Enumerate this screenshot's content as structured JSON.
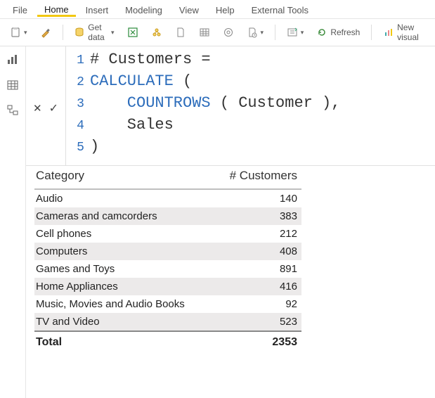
{
  "menubar": {
    "items": [
      {
        "label": "File",
        "active": false
      },
      {
        "label": "Home",
        "active": true
      },
      {
        "label": "Insert",
        "active": false
      },
      {
        "label": "Modeling",
        "active": false
      },
      {
        "label": "View",
        "active": false
      },
      {
        "label": "Help",
        "active": false
      },
      {
        "label": "External Tools",
        "active": false
      }
    ]
  },
  "toolbar": {
    "get_data_label": "Get data",
    "refresh_label": "Refresh",
    "new_visual_label": "New visual"
  },
  "formula": {
    "lines": [
      {
        "n": "1",
        "tokens": [
          {
            "t": "# Customers ",
            "c": "txt"
          },
          {
            "t": "=",
            "c": "txt"
          }
        ]
      },
      {
        "n": "2",
        "tokens": [
          {
            "t": "CALCULATE",
            "c": "kw"
          },
          {
            "t": " (",
            "c": "par"
          }
        ]
      },
      {
        "n": "3",
        "tokens": [
          {
            "t": "    ",
            "c": "txt"
          },
          {
            "t": "COUNTROWS",
            "c": "kw"
          },
          {
            "t": " ( Customer ),",
            "c": "txt"
          }
        ]
      },
      {
        "n": "4",
        "tokens": [
          {
            "t": "    Sales",
            "c": "txt"
          }
        ]
      },
      {
        "n": "5",
        "tokens": [
          {
            "t": ")",
            "c": "par"
          }
        ]
      }
    ]
  },
  "table": {
    "header_category": "Category",
    "header_count": "# Customers",
    "rows": [
      {
        "category": "Audio",
        "count": "140"
      },
      {
        "category": "Cameras and camcorders",
        "count": "383"
      },
      {
        "category": "Cell phones",
        "count": "212"
      },
      {
        "category": "Computers",
        "count": "408"
      },
      {
        "category": "Games and Toys",
        "count": "891"
      },
      {
        "category": "Home Appliances",
        "count": "416"
      },
      {
        "category": "Music, Movies and Audio Books",
        "count": "92"
      },
      {
        "category": "TV and Video",
        "count": "523"
      }
    ],
    "total_label": "Total",
    "total_value": "2353"
  },
  "chart_data": {
    "type": "table",
    "title": "# Customers by Category",
    "categories": [
      "Audio",
      "Cameras and camcorders",
      "Cell phones",
      "Computers",
      "Games and Toys",
      "Home Appliances",
      "Music, Movies and Audio Books",
      "TV and Video"
    ],
    "values": [
      140,
      383,
      212,
      408,
      891,
      416,
      92,
      523
    ],
    "total": 2353
  }
}
